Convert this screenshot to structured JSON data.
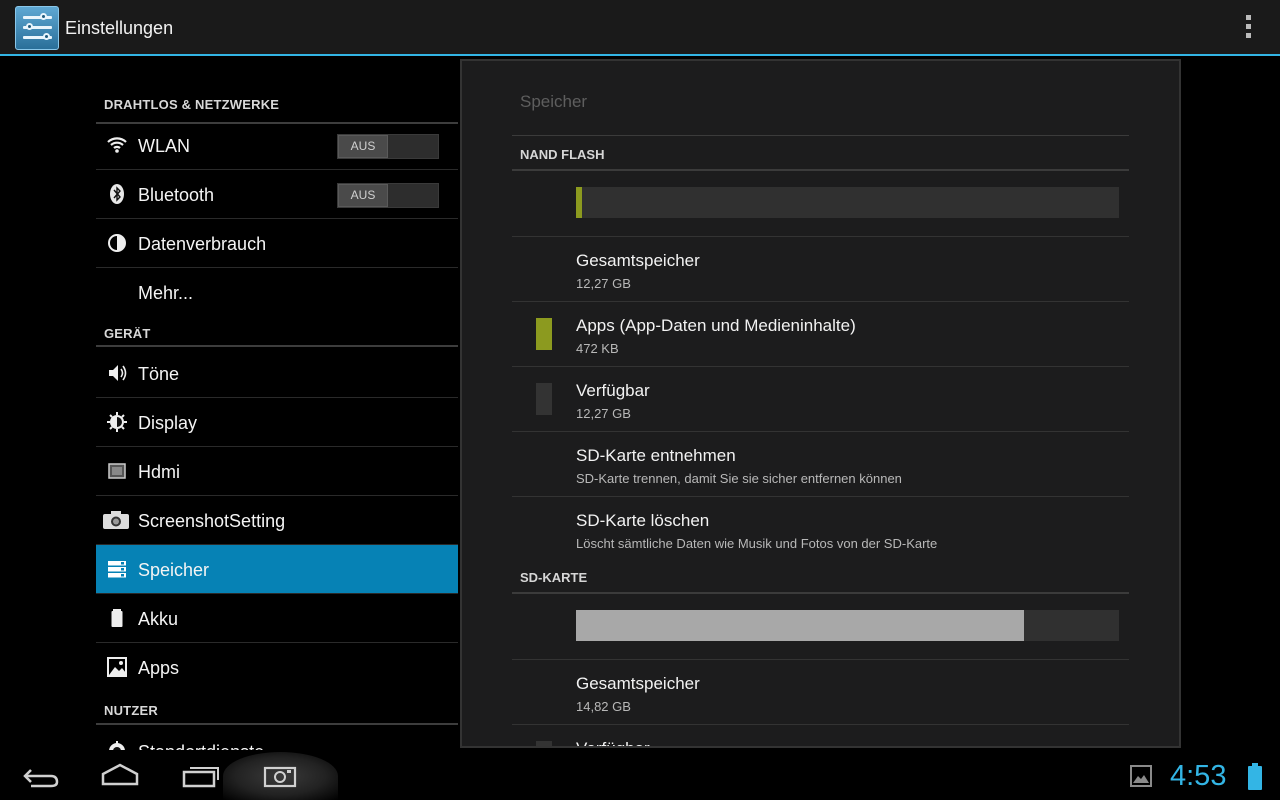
{
  "actionbar": {
    "title": "Einstellungen",
    "app_icon": "settings-icon",
    "overflow_icon": "overflow-menu-icon"
  },
  "sidebar": {
    "sections": [
      {
        "label": "DRAHTLOS & NETZWERKE"
      },
      {
        "label": "GERÄT"
      },
      {
        "label": "NUTZER"
      }
    ],
    "items": [
      {
        "label": "WLAN",
        "icon": "wifi-icon",
        "toggle": "AUS"
      },
      {
        "label": "Bluetooth",
        "icon": "bluetooth-icon",
        "toggle": "AUS"
      },
      {
        "label": "Datenverbrauch",
        "icon": "data-usage-icon"
      },
      {
        "label": "Mehr...",
        "icon": ""
      },
      {
        "label": "Töne",
        "icon": "volume-icon"
      },
      {
        "label": "Display",
        "icon": "brightness-icon"
      },
      {
        "label": "Hdmi",
        "icon": "hdmi-icon"
      },
      {
        "label": "ScreenshotSetting",
        "icon": "camera-icon"
      },
      {
        "label": "Speicher",
        "icon": "storage-icon",
        "selected": true
      },
      {
        "label": "Akku",
        "icon": "battery-icon"
      },
      {
        "label": "Apps",
        "icon": "apps-icon"
      },
      {
        "label": "Standortdienste",
        "icon": "location-icon"
      }
    ]
  },
  "storage": {
    "title": "Speicher",
    "nand": {
      "header": "NAND FLASH",
      "usage_fraction": 0.01,
      "total_label": "Gesamtspeicher",
      "total_value": "12,27 GB",
      "apps_label": "Apps (App-Daten und Medieninhalte)",
      "apps_value": "472 KB",
      "free_label": "Verfügbar",
      "free_value": "12,27 GB",
      "unmount_label": "SD-Karte entnehmen",
      "unmount_desc": "SD-Karte trennen, damit Sie sie sicher entfernen können",
      "erase_label": "SD-Karte löschen",
      "erase_desc": "Löscht sämtliche Daten wie Musik und Fotos von der SD-Karte"
    },
    "sd": {
      "header": "SD-KARTE",
      "usage_fraction": 0.825,
      "total_label": "Gesamtspeicher",
      "total_value": "14,82 GB",
      "free_label": "Verfügbar"
    },
    "colors": {
      "apps": "#8c9a1f",
      "free": "#333333",
      "used_sd": "#a8a8a8"
    }
  },
  "navbar": {
    "back_icon": "back-icon",
    "home_icon": "home-icon",
    "recents_icon": "recent-apps-icon",
    "screenshot_icon": "screenshot-icon",
    "clock": "4:53"
  }
}
